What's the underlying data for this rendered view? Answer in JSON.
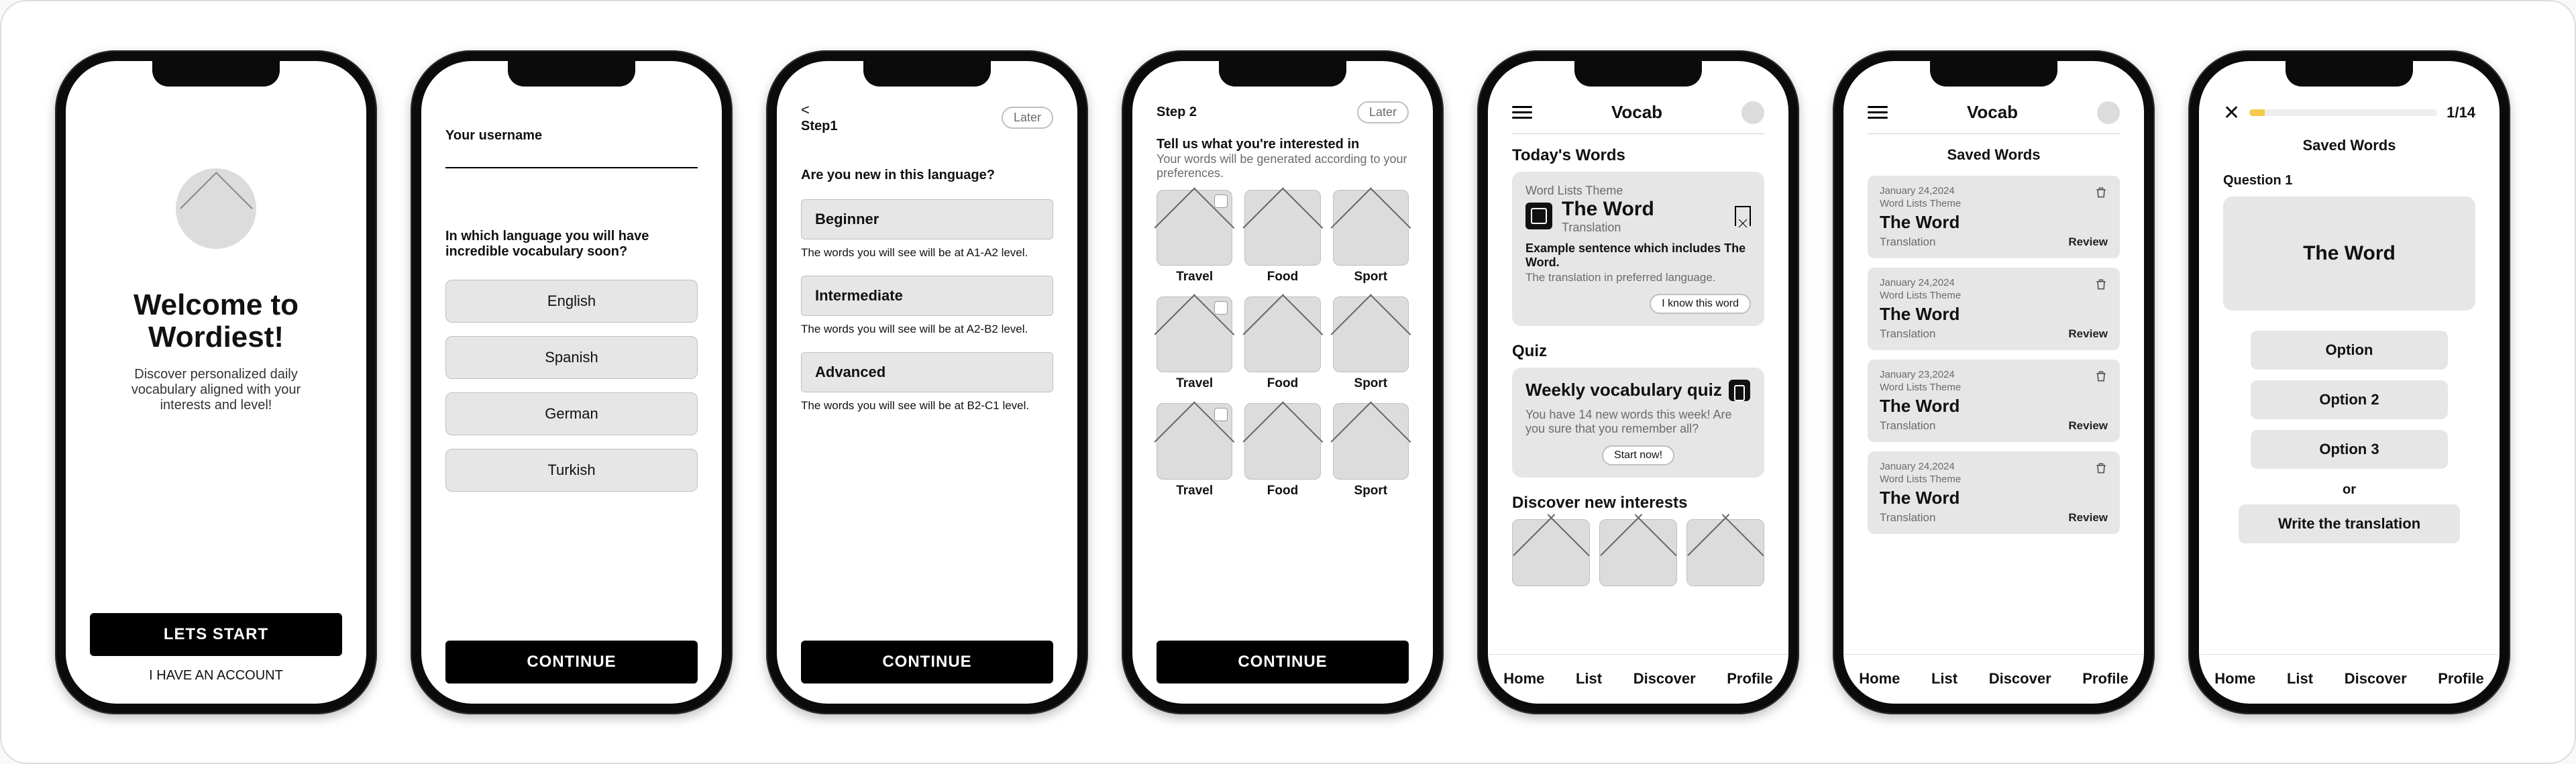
{
  "screen1": {
    "title": "Welcome to Wordiest!",
    "subtitle": "Discover personalized daily vocabulary aligned with your interests and level!",
    "cta": "LETS START",
    "secondary": "I HAVE AN ACCOUNT"
  },
  "screen2": {
    "username_label": "Your username",
    "question": "In which language you will have incredible vocabulary soon?",
    "options": [
      "English",
      "Spanish",
      "German",
      "Turkish"
    ],
    "continue": "CONTINUE"
  },
  "screen3": {
    "back": "<",
    "step": "Step1",
    "later": "Later",
    "question": "Are you new in this language?",
    "levels": [
      {
        "name": "Beginner",
        "note": "The words you will see will be at A1-A2 level."
      },
      {
        "name": "Intermediate",
        "note": "The words you will see will be at A2-B2 level."
      },
      {
        "name": "Advanced",
        "note": "The words you will see will be at B2-C1 level."
      }
    ],
    "continue": "CONTINUE"
  },
  "screen4": {
    "step": "Step 2",
    "later": "Later",
    "title": "Tell us what you're interested in",
    "subtitle": "Your words will be generated according to your preferences.",
    "grid": [
      "Travel",
      "Food",
      "Sport",
      "Travel",
      "Food",
      "Sport",
      "Travel",
      "Food",
      "Sport"
    ],
    "continue": "CONTINUE"
  },
  "screen5": {
    "header": "Vocab",
    "todays": "Today's Words",
    "word_card": {
      "theme": "Word Lists Theme",
      "word": "The Word",
      "sub": "Translation",
      "example": "Example sentence which includes The Word.",
      "translation": "The translation in preferred language.",
      "know": "I know this word"
    },
    "quiz_section": "Quiz",
    "quiz_card": {
      "title": "Weekly vocabulary quiz",
      "text": "You have 14 new words this week! Are you sure that you remember all?",
      "cta": "Start now!"
    },
    "discover": "Discover new interests",
    "nav": [
      "Home",
      "List",
      "Discover",
      "Profile"
    ]
  },
  "screen6": {
    "header": "Vocab",
    "title": "Saved Words",
    "items": [
      {
        "date": "January 24,2024",
        "theme": "Word Lists Theme",
        "word": "The Word",
        "sub": "Translation",
        "review": "Review"
      },
      {
        "date": "January 24,2024",
        "theme": "Word Lists Theme",
        "word": "The Word",
        "sub": "Translation",
        "review": "Review"
      },
      {
        "date": "January 23,2024",
        "theme": "Word Lists Theme",
        "word": "The Word",
        "sub": "Translation",
        "review": "Review"
      },
      {
        "date": "January 24,2024",
        "theme": "Word Lists Theme",
        "word": "The Word",
        "sub": "Translation",
        "review": "Review"
      }
    ],
    "nav": [
      "Home",
      "List",
      "Discover",
      "Profile"
    ]
  },
  "screen7": {
    "counter": "1/14",
    "title": "Saved Words",
    "question": "Question 1",
    "word": "The Word",
    "options": [
      "Option",
      "Option 2",
      "Option 3"
    ],
    "or": "or",
    "write": "Write the translation",
    "nav": [
      "Home",
      "List",
      "Discover",
      "Profile"
    ]
  }
}
